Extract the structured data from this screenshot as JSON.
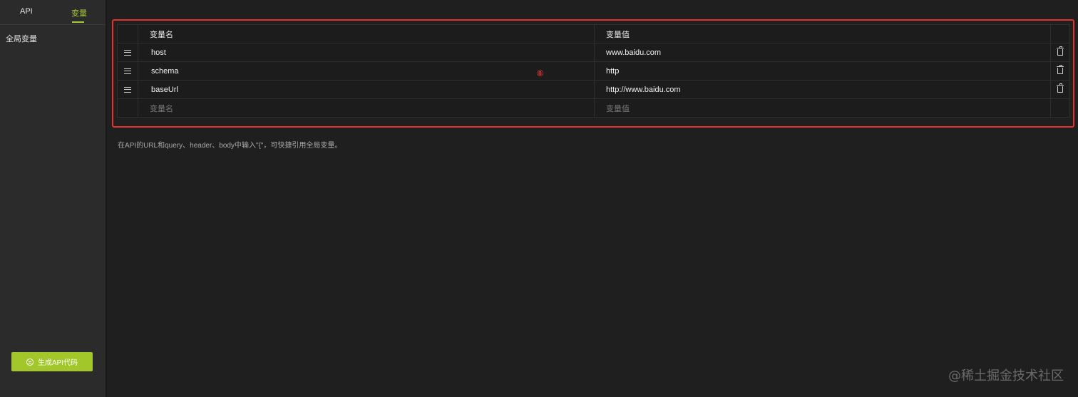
{
  "sidebar": {
    "tabs": [
      {
        "label": "API"
      },
      {
        "label": "变量"
      }
    ],
    "items": [
      {
        "label": "全局变量"
      }
    ],
    "generate_button": {
      "label": "生成API代码",
      "icon": "code-icon"
    }
  },
  "table": {
    "headers": {
      "name": "变量名",
      "value": "变量值"
    },
    "rows": [
      {
        "name": "host",
        "value": "www.baidu.com"
      },
      {
        "name": "schema",
        "value": "http"
      },
      {
        "name": "baseUrl",
        "value": "http://www.baidu.com"
      }
    ],
    "new_row": {
      "name_placeholder": "变量名",
      "value_placeholder": "变量值"
    }
  },
  "annotation": {
    "marker": "⑧",
    "color": "#e5322d"
  },
  "hint": "在API的URL和query、header、body中输入\"{\"，可快捷引用全局变量。",
  "watermark": "@稀土掘金技术社区",
  "colors": {
    "accent": "#a6c93a",
    "background": "#1f1f1f",
    "sidebar": "#2b2b2b"
  }
}
